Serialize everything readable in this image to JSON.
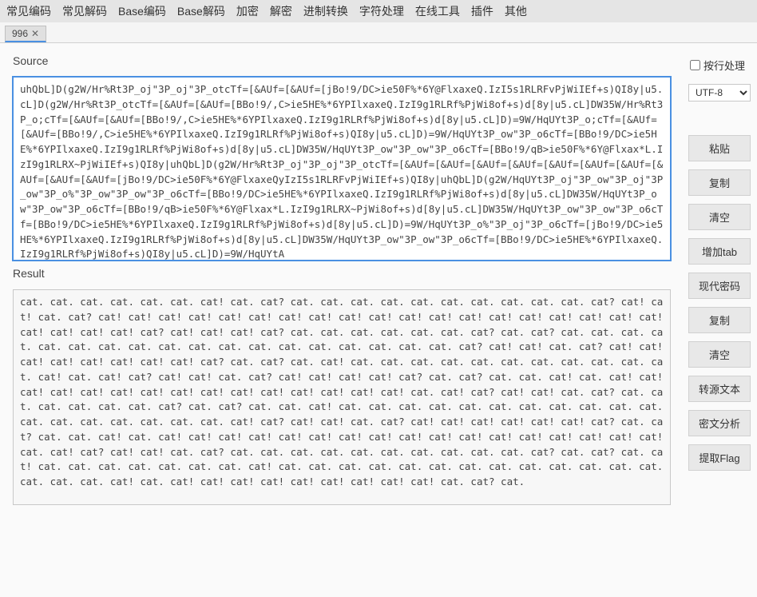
{
  "menu": {
    "items": [
      "常见编码",
      "常见解码",
      "Base编码",
      "Base解码",
      "加密",
      "解密",
      "进制转换",
      "字符处理",
      "在线工具",
      "插件",
      "其他"
    ]
  },
  "tab": {
    "label": "996",
    "close_glyph": "✕"
  },
  "source": {
    "label": "Source",
    "value": "uhQbL]D(g2W/Hr%Rt3P_oj\"3P_oj\"3P_otcTf=[&AUf=[&AUf=[jBo!9/DC>ie50F%*6Y@FlxaxeQ.IzI5s1RLRFvPjWiIEf+s)QI8y|u5.cL]D(g2W/Hr%Rt3P_otcTf=[&AUf=[&AUf=[BBo!9/,C>ie5HE%*6YPIlxaxeQ.IzI9g1RLRf%PjWi8of+s)d[8y|u5.cL]DW35W/Hr%Rt3P_o;cTf=[&AUf=[&AUf=[BBo!9/,C>ie5HE%*6YPIlxaxeQ.IzI9g1RLRf%PjWi8of+s)d[8y|u5.cL]D)=9W/HqUYt3P_o;cTf=[&AUf=[&AUf=[BBo!9/,C>ie5HE%*6YPIlxaxeQ.IzI9g1RLRf%PjWi8of+s)QI8y|u5.cL]D)=9W/HqUYt3P_ow\"3P_o6cTf=[BBo!9/DC>ie5HE%*6YPIlxaxeQ.IzI9g1RLRf%PjWi8of+s)d[8y|u5.cL]DW35W/HqUYt3P_ow\"3P_ow\"3P_o6cTf=[BBo!9/qB>ie50F%*6Y@Flxax*L.IzI9g1RLRX~PjWiIEf+s)QI8y|uhQbL]D(g2W/Hr%Rt3P_oj\"3P_oj\"3P_otcTf=[&AUf=[&AUf=[&AUf=[&AUf=[&AUf=[&AUf=[&AUf=[&AUf=[&AUf=[&AUf=[jBo!9/DC>ie50F%*6Y@FlxaxeQyIzI5s1RLRFvPjWiIEf+s)QI8y|uhQbL]D(g2W/HqUYt3P_oj\"3P_ow\"3P_oj\"3P_ow\"3P_o%\"3P_ow\"3P_ow\"3P_o6cTf=[BBo!9/DC>ie5HE%*6YPIlxaxeQ.IzI9g1RLRf%PjWi8of+s)d[8y|u5.cL]DW35W/HqUYt3P_ow\"3P_ow\"3P_o6cTf=[BBo!9/qB>ie50F%*6Y@Flxax*L.IzI9g1RLRX~PjWi8of+s)d[8y|u5.cL]DW35W/HqUYt3P_ow\"3P_ow\"3P_o6cTf=[BBo!9/DC>ie5HE%*6YPIlxaxeQ.IzI9g1RLRf%PjWi8of+s)d[8y|u5.cL]D)=9W/HqUYt3P_o%\"3P_oj\"3P_o6cTf=[jBo!9/DC>ie5HE%*6YPIlxaxeQ.IzI9g1RLRf%PjWi8of+s)d[8y|u5.cL]DW35W/HqUYt3P_ow\"3P_ow\"3P_o6cTf=[BBo!9/DC>ie5HE%*6YPIlxaxeQ.IzI9g1RLRf%PjWi8of+s)QI8y|u5.cL]D)=9W/HqUYtA"
  },
  "result": {
    "label": "Result",
    "value": "cat. cat. cat. cat. cat. cat. cat! cat. cat? cat. cat. cat. cat. cat. cat. cat. cat. cat. cat. cat? cat! cat! cat. cat? cat! cat! cat! cat! cat! cat! cat! cat! cat! cat! cat! cat! cat! cat! cat! cat! cat! cat! cat! cat! cat! cat! cat! cat? cat! cat! cat! cat? cat. cat. cat. cat. cat. cat. cat? cat. cat? cat. cat. cat. cat. cat. cat. cat. cat. cat. cat. cat. cat. cat. cat. cat. cat. cat. cat. cat? cat! cat! cat. cat? cat! cat! cat! cat! cat! cat! cat! cat! cat? cat. cat? cat. cat! cat. cat. cat. cat. cat. cat. cat. cat. cat. cat. cat. cat! cat. cat! cat? cat! cat! cat. cat? cat! cat! cat! cat! cat? cat. cat? cat. cat. cat! cat. cat! cat! cat! cat! cat! cat! cat! cat! cat! cat! cat! cat! cat! cat! cat! cat. cat! cat? cat! cat! cat. cat? cat. cat. cat. cat. cat. cat. cat? cat. cat? cat. cat. cat! cat. cat. cat. cat. cat. cat. cat. cat. cat. cat. cat. cat. cat. cat. cat. cat. cat. cat. cat! cat? cat! cat! cat. cat? cat! cat! cat! cat! cat! cat! cat? cat. cat? cat. cat. cat! cat. cat! cat! cat! cat! cat! cat! cat! cat! cat! cat! cat! cat! cat! cat! cat! cat! cat! cat. cat! cat? cat! cat! cat. cat? cat. cat. cat. cat. cat. cat. cat. cat. cat. cat. cat? cat. cat? cat. cat! cat. cat. cat. cat. cat. cat. cat. cat! cat. cat. cat. cat. cat. cat. cat. cat. cat. cat. cat. cat. cat. cat. cat. cat. cat! cat. cat! cat! cat! cat! cat! cat! cat! cat! cat! cat. cat? cat."
  },
  "side": {
    "byline_label": "按行处理",
    "encoding": "UTF-8",
    "buttons": {
      "paste": "粘贴",
      "copy1": "复制",
      "clear1": "清空",
      "addtab": "增加tab",
      "modern": "现代密码",
      "copy2": "复制",
      "clear2": "清空",
      "toSource": "转源文本",
      "analyze": "密文分析",
      "extractFlag": "提取Flag"
    }
  }
}
